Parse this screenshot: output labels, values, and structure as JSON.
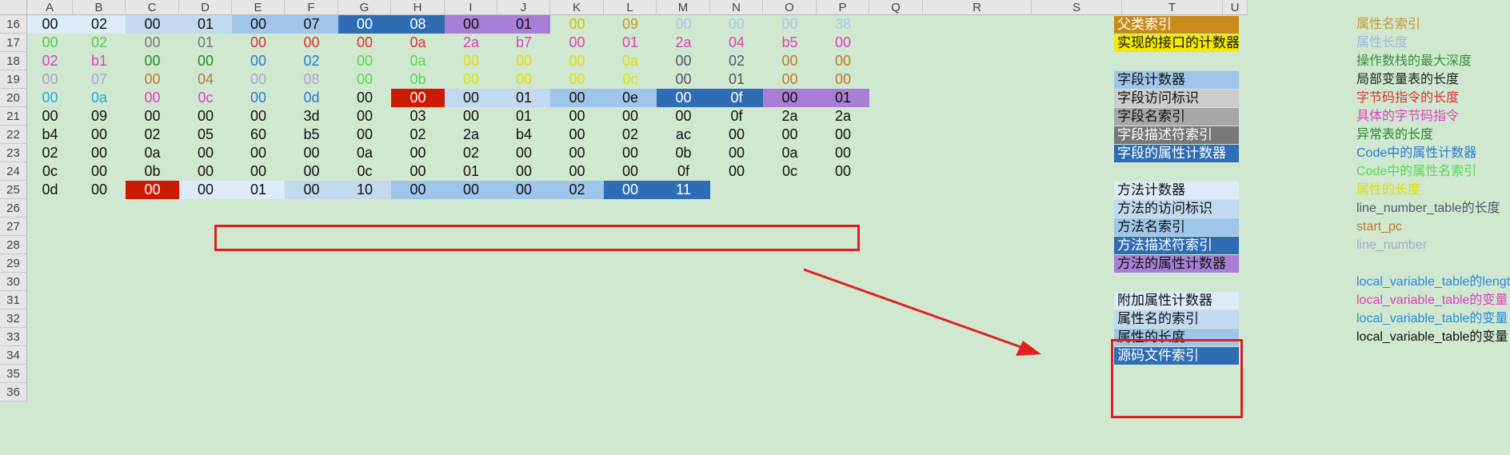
{
  "columns": [
    "A",
    "B",
    "C",
    "D",
    "E",
    "F",
    "G",
    "H",
    "I",
    "J",
    "K",
    "L",
    "M",
    "N",
    "O",
    "P",
    "Q",
    "R",
    "S",
    "T",
    "U"
  ],
  "row_numbers": [
    "16",
    "17",
    "18",
    "19",
    "20",
    "21",
    "22",
    "23",
    "24",
    "25",
    "26",
    "27",
    "28",
    "29",
    "30",
    "31",
    "32",
    "33",
    "34",
    "35",
    "36"
  ],
  "rows": [
    [
      "00",
      "02",
      "00",
      "01",
      "00",
      "07",
      "00",
      "08",
      "00",
      "01",
      "00",
      "09",
      "00",
      "00",
      "00",
      "38"
    ],
    [
      "00",
      "02",
      "00",
      "01",
      "00",
      "00",
      "00",
      "0a",
      "2a",
      "b7",
      "00",
      "01",
      "2a",
      "04",
      "b5",
      "00"
    ],
    [
      "02",
      "b1",
      "00",
      "00",
      "00",
      "02",
      "00",
      "0a",
      "00",
      "00",
      "00",
      "0a",
      "00",
      "02",
      "00",
      "00"
    ],
    [
      "00",
      "07",
      "00",
      "04",
      "00",
      "08",
      "00",
      "0b",
      "00",
      "00",
      "00",
      "0c",
      "00",
      "01",
      "00",
      "00"
    ],
    [
      "00",
      "0a",
      "00",
      "0c",
      "00",
      "0d",
      "00",
      "00",
      "00",
      "01",
      "00",
      "0e",
      "00",
      "0f",
      "00",
      "01"
    ],
    [
      "00",
      "09",
      "00",
      "00",
      "00",
      "3d",
      "00",
      "03",
      "00",
      "01",
      "00",
      "00",
      "00",
      "0f",
      "2a",
      "2a"
    ],
    [
      "b4",
      "00",
      "02",
      "05",
      "60",
      "b5",
      "00",
      "02",
      "2a",
      "b4",
      "00",
      "02",
      "ac",
      "00",
      "00",
      "00"
    ],
    [
      "02",
      "00",
      "0a",
      "00",
      "00",
      "00",
      "0a",
      "00",
      "02",
      "00",
      "00",
      "00",
      "0b",
      "00",
      "0a",
      "00"
    ],
    [
      "0c",
      "00",
      "0b",
      "00",
      "00",
      "00",
      "0c",
      "00",
      "01",
      "00",
      "00",
      "00",
      "0f",
      "00",
      "0c",
      "00"
    ],
    [
      "0d",
      "00",
      "00",
      "00",
      "01",
      "00",
      "10",
      "00",
      "00",
      "00",
      "02",
      "00",
      "11",
      "",
      "",
      ""
    ]
  ],
  "r_labels": [
    {
      "text": "父类索引",
      "bg": "#c98c1a",
      "color": "#ffffff"
    },
    {
      "text": "实现的接口的计数器",
      "bg": "#f2ea00",
      "color": "#111111"
    },
    {
      "text": "字段计数器",
      "bg": "#9fc5ea",
      "color": "#111111"
    },
    {
      "text": "字段访问标识",
      "bg": "#cccccc",
      "color": "#111111"
    },
    {
      "text": "字段名索引",
      "bg": "#a8a8a8",
      "color": "#111111"
    },
    {
      "text": "字段描述符索引",
      "bg": "#787878",
      "color": "#ffffff"
    },
    {
      "text": "字段的属性计数器",
      "bg": "#2e6db4",
      "color": "#ffffff"
    },
    {
      "text": "方法计数器",
      "bg": "#ddeaf8",
      "color": "#111111"
    },
    {
      "text": "方法的访问标识",
      "bg": "#c2d9f0",
      "color": "#111111"
    },
    {
      "text": "方法名索引",
      "bg": "#9fc5ea",
      "color": "#111111"
    },
    {
      "text": "方法描述符索引",
      "bg": "#2e6db4",
      "color": "#ffffff"
    },
    {
      "text": "方法的属性计数器",
      "bg": "#a87ed6",
      "color": "#111111"
    },
    {
      "text": "附加属性计数器",
      "bg": "#ddeaf8",
      "color": "#111111"
    },
    {
      "text": "属性名的索引",
      "bg": "#c2d9f0",
      "color": "#111111"
    },
    {
      "text": "属性的长度",
      "bg": "#9fc5ea",
      "color": "#111111"
    },
    {
      "text": "源码文件索引",
      "bg": "#2e6db4",
      "color": "#ffffff"
    }
  ],
  "t_labels": [
    {
      "text": "属性名索引",
      "color": "#c99a2e"
    },
    {
      "text": "属性长度",
      "color": "#9fb8e0"
    },
    {
      "text": "操作数栈的最大深度",
      "color": "#3a8f3a"
    },
    {
      "text": "局部变量表的长度",
      "color": "#222222"
    },
    {
      "text": "字节码指令的长度",
      "color": "#e03030"
    },
    {
      "text": "具体的字节码指令",
      "color": "#e040c0"
    },
    {
      "text": "异常表的长度",
      "color": "#2a8a2a"
    },
    {
      "text": "Code中的属性计数器",
      "color": "#2a7ad8"
    },
    {
      "text": "Code中的属性名索引",
      "color": "#58d858"
    },
    {
      "text": "属性的长度",
      "color": "#e0e000"
    },
    {
      "text": "line_number_table的长度",
      "color": "#555566"
    },
    {
      "text": "start_pc",
      "color": "#c07830"
    },
    {
      "text": "line_number",
      "color": "#a8a8c8"
    },
    {
      "text": "local_variable_table的length",
      "color": "#2a8ae0"
    },
    {
      "text": "local_variable_table的变量",
      "color": "#e040c0"
    },
    {
      "text": "local_variable_table的变量",
      "color": "#2a8ae0"
    },
    {
      "text": "local_variable_table的变量",
      "color": "#111111"
    }
  ]
}
